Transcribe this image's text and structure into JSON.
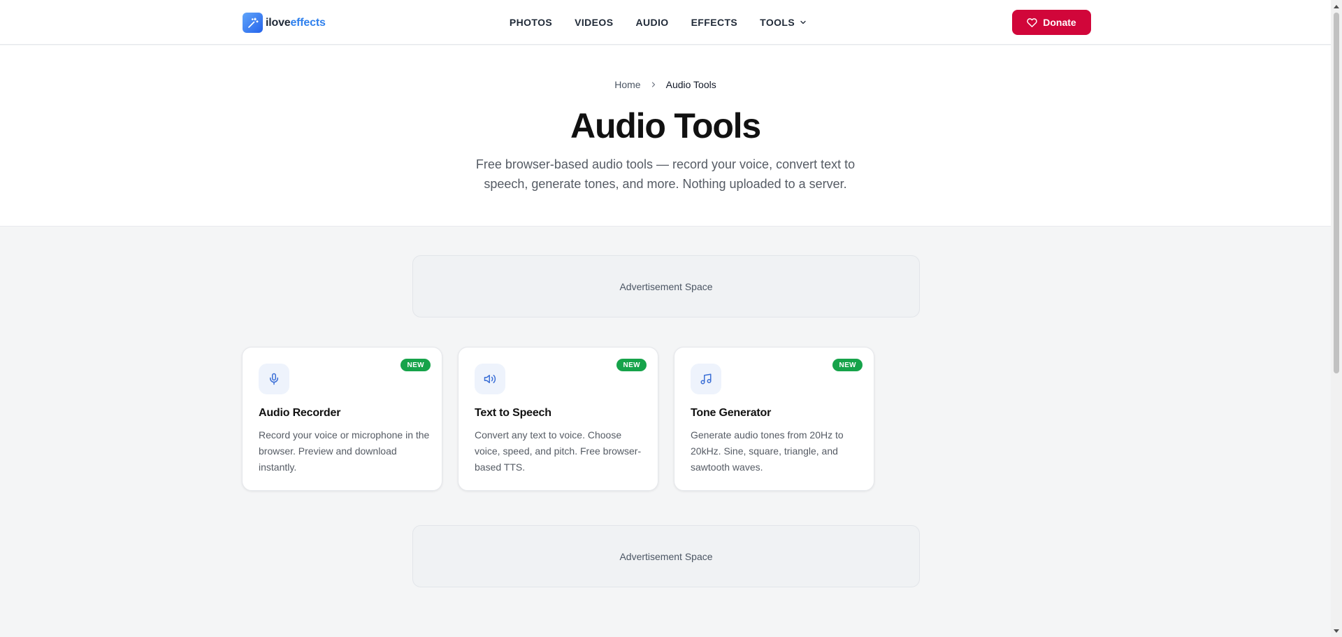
{
  "brand": {
    "name_part1": "ilove",
    "name_part2": "effects",
    "primary_color": "#2f80ed",
    "donate_color": "#d1063a",
    "badge_color": "#16a34a"
  },
  "nav": {
    "items": [
      {
        "label": "PHOTOS"
      },
      {
        "label": "VIDEOS"
      },
      {
        "label": "AUDIO"
      },
      {
        "label": "EFFECTS"
      },
      {
        "label": "TOOLS",
        "icon": "chevron-down-icon"
      }
    ]
  },
  "donate": {
    "label": "Donate",
    "icon": "heart-icon"
  },
  "breadcrumb": {
    "home": "Home",
    "separator_icon": "chevron-right-icon",
    "current": "Audio Tools"
  },
  "hero": {
    "title": "Audio Tools",
    "subtitle": "Free browser-based audio tools — record your voice, convert text to speech, generate tones, and more. Nothing uploaded to a server."
  },
  "ads": {
    "top": "Advertisement Space",
    "bottom": "Advertisement Space"
  },
  "tools": [
    {
      "icon": "microphone-icon",
      "badge": "NEW",
      "title": "Audio Recorder",
      "description": "Record your voice or microphone in the browser. Preview and download instantly."
    },
    {
      "icon": "speaker-icon",
      "badge": "NEW",
      "title": "Text to Speech",
      "description": "Convert any text to voice. Choose voice, speed, and pitch. Free browser-based TTS."
    },
    {
      "icon": "music-note-icon",
      "badge": "NEW",
      "title": "Tone Generator",
      "description": "Generate audio tones from 20Hz to 20kHz. Sine, square, triangle, and sawtooth waves."
    }
  ]
}
